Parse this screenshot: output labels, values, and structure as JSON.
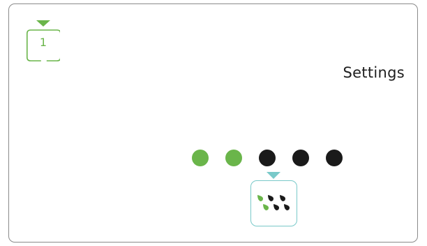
{
  "indicator": {
    "number": "1",
    "icon": "step-indicator-icon",
    "color": "#6ab54a"
  },
  "title": "Settings",
  "progress": {
    "total": 5,
    "completed": 2,
    "active_color": "#6ab54a",
    "inactive_color": "#1a1a1a"
  },
  "selected_tile": {
    "icon": "water-drops-icon",
    "accent_color": "#79c9c9"
  }
}
